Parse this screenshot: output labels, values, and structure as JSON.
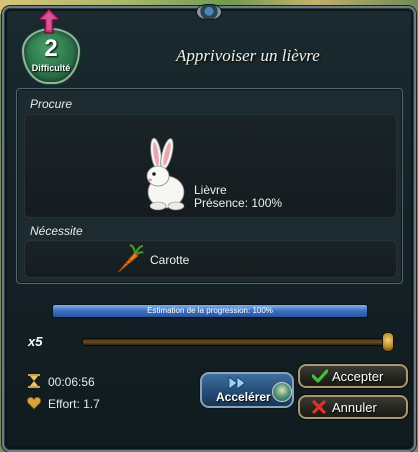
{
  "dialog": {
    "title": "Apprivoiser un lièvre",
    "difficulty": {
      "value": "2",
      "label": "Difficulté"
    }
  },
  "provides": {
    "section_label": "Procure",
    "item_name": "Lièvre",
    "presence": "Présence: 100%",
    "icon": "rabbit-icon"
  },
  "requires": {
    "section_label": "Nécessite",
    "item_name": "Carotte",
    "icon": "carrot-icon"
  },
  "progress": {
    "label": "Estimation de la progression: 100%",
    "value_percent": 100
  },
  "multiplier": {
    "label": "x5",
    "slider_value_fraction": 1.0
  },
  "stats": {
    "duration": "00:06:56",
    "effort": "Effort: 1.7"
  },
  "buttons": {
    "accelerate": "Accelérer",
    "accept": "Accepter",
    "cancel": "Annuler"
  },
  "colors": {
    "badge_green": "#2f7a4d",
    "progress_blue": "#3b6fc0",
    "accept_green": "#3fc03a",
    "cancel_red": "#e0302a"
  }
}
